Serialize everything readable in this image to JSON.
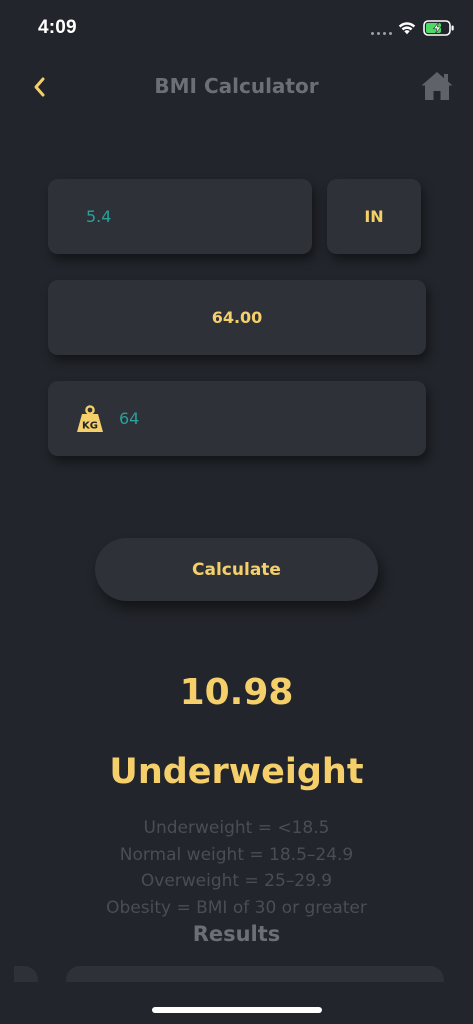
{
  "status_bar": {
    "time": "4:09"
  },
  "header": {
    "title": "BMI Calculator",
    "back_icon": "chevron-left-icon",
    "home_icon": "home-icon"
  },
  "form": {
    "height_value": "5.4",
    "unit_label": "IN",
    "height_display": "64.00",
    "weight_value": "64",
    "weight_icon": "kg-weight-icon"
  },
  "calculate_button": {
    "label": "Calculate"
  },
  "result": {
    "bmi": "10.98",
    "category": "Underweight",
    "ranges": [
      "Underweight = <18.5",
      "Normal weight = 18.5–24.9",
      "Overweight = 25–29.9",
      "Obesity = BMI of 30 or greater"
    ],
    "results_heading": "Results"
  },
  "colors": {
    "background": "#22252b",
    "card": "#2e3238",
    "accent_yellow": "#f5d06a",
    "teal": "#2aa19a",
    "muted_text": "#4a4e54",
    "title_gray": "#6c7075"
  }
}
